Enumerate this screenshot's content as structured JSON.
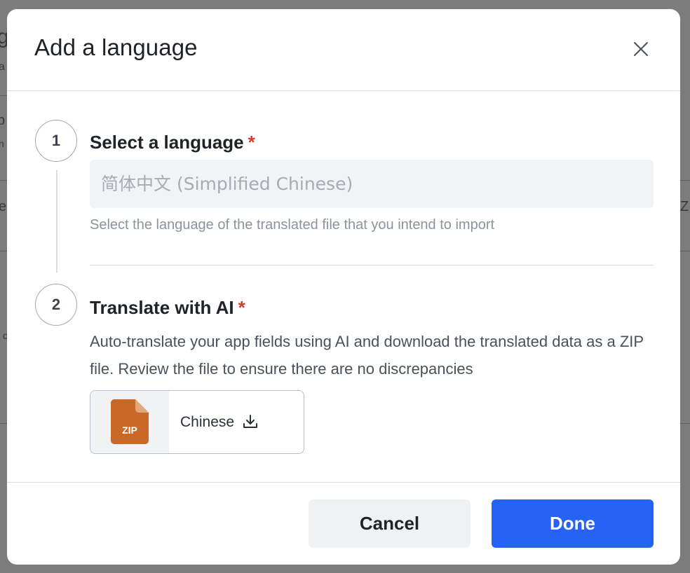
{
  "modal": {
    "title": "Add a language"
  },
  "steps": [
    {
      "number": "1",
      "title": "Select a language",
      "required_mark": "*",
      "input_placeholder": "简体中文 (Simplified Chinese)",
      "helper": "Select the language of the translated file that you intend to import"
    },
    {
      "number": "2",
      "title": "Translate with AI",
      "required_mark": "*",
      "description": "Auto-translate your app fields using AI and download the translated data as a ZIP file. Review the file to ensure there are no discrepancies",
      "file": {
        "type_label": "ZIP",
        "name": "Chinese",
        "icon": "download-icon"
      }
    }
  ],
  "footer": {
    "cancel_label": "Cancel",
    "done_label": "Done"
  },
  "colors": {
    "primary": "#2563f5",
    "required": "#d33b2c",
    "zip_icon": "#c8692a"
  }
}
